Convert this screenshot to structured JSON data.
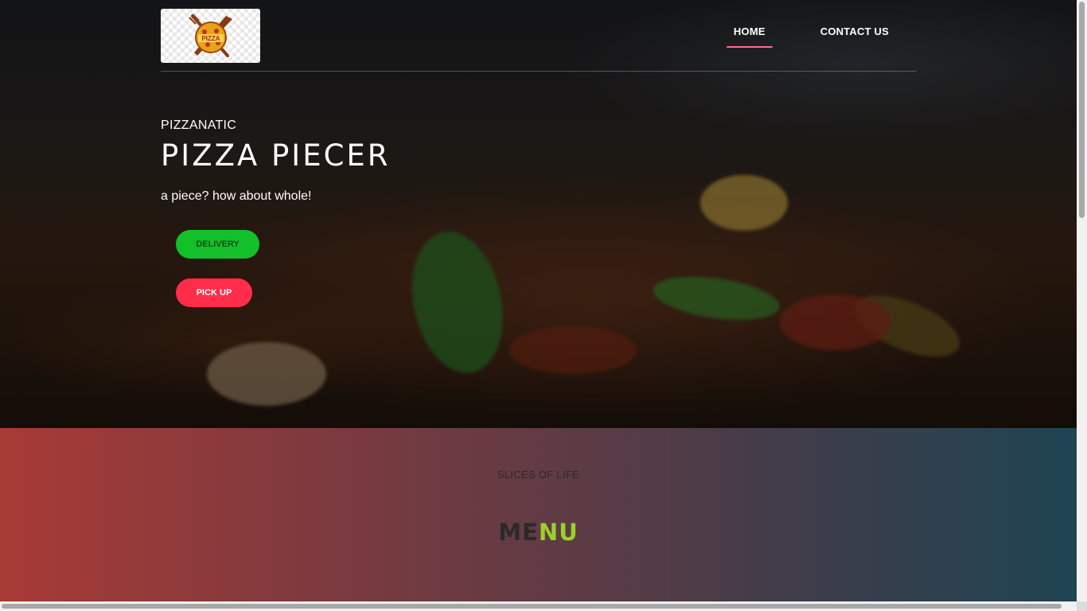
{
  "brand": {
    "logo_text": "PIZZA"
  },
  "nav": {
    "items": [
      {
        "label": "HOME",
        "active": true
      },
      {
        "label": "CONTACT US",
        "active": false
      }
    ]
  },
  "hero": {
    "eyebrow": "PIZZANATIC",
    "title": "PIZZA PIECER",
    "tagline": "a piece? how about whole!",
    "buttons": {
      "delivery": "DELIVERY",
      "pickup": "PICK UP"
    }
  },
  "menu_section": {
    "kicker": "SLICES OF LIFE",
    "heading_part1": "ME",
    "heading_part2": "NU"
  },
  "colors": {
    "nav_active_underline": "#ff6b8a",
    "delivery_button": "#14c02a",
    "pickup_button": "#ff2d4a",
    "menu_accent": "#9bd12b"
  }
}
